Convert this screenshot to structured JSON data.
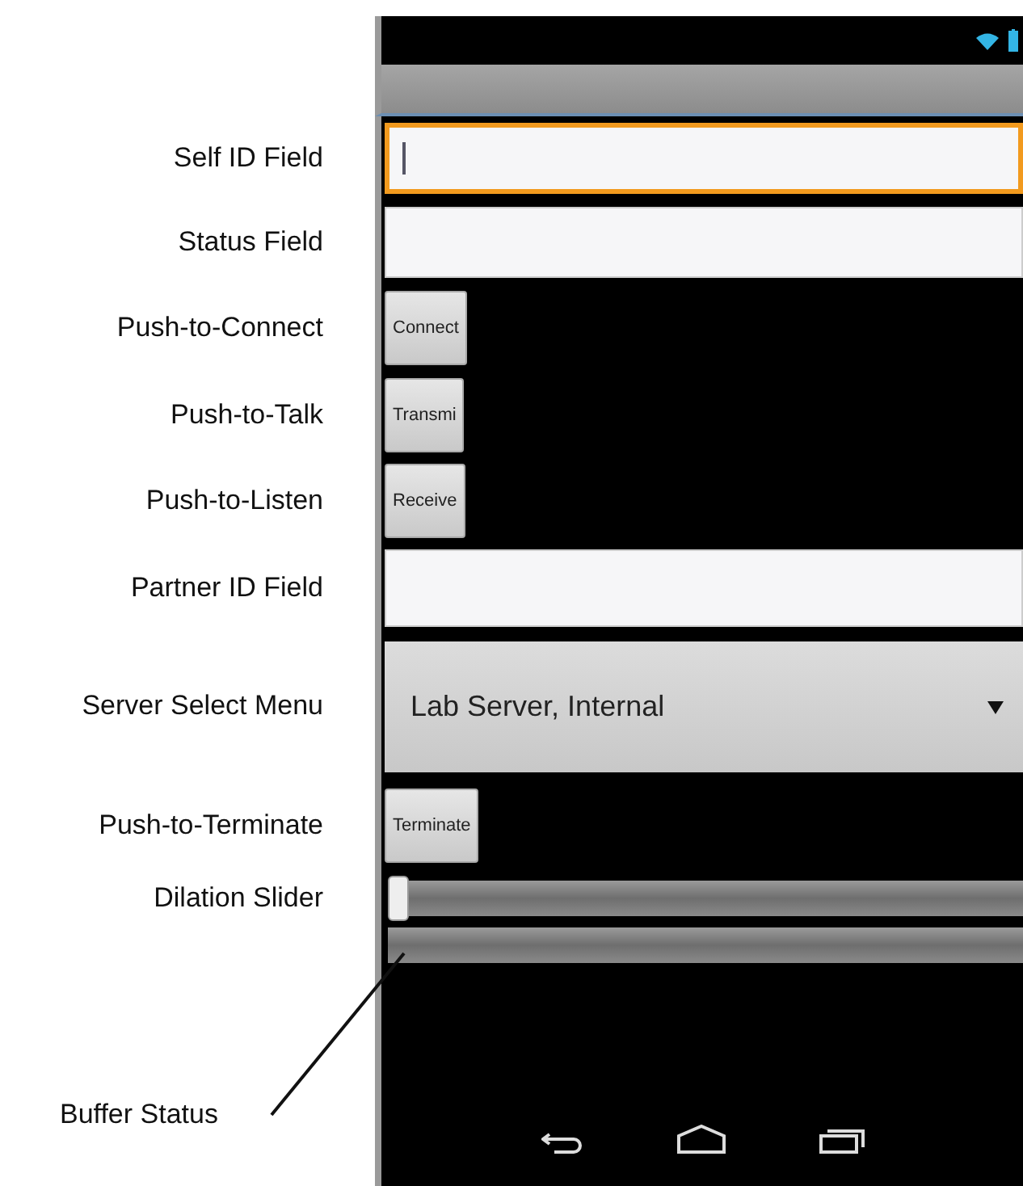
{
  "controls": [
    {
      "kind": "field",
      "annotation": "Self ID Field",
      "focused": true
    },
    {
      "kind": "field",
      "annotation": "Status Field",
      "focused": false
    },
    {
      "kind": "button",
      "annotation": "Push-to-Connect",
      "label": "Connect"
    },
    {
      "kind": "button",
      "annotation": "Push-to-Talk",
      "label": "Transmi"
    },
    {
      "kind": "button",
      "annotation": "Push-to-Listen",
      "label": "Receive"
    },
    {
      "kind": "field",
      "annotation": "Partner ID Field",
      "focused": false
    },
    {
      "kind": "select",
      "annotation": "Server Select Menu",
      "value": "Lab Server, Internal"
    },
    {
      "kind": "button",
      "annotation": "Push-to-Terminate",
      "label": "Terminate"
    },
    {
      "kind": "slider",
      "annotation": "Dilation Slider",
      "level": 0
    }
  ],
  "buffer": {
    "callout": "Buffer Status"
  }
}
